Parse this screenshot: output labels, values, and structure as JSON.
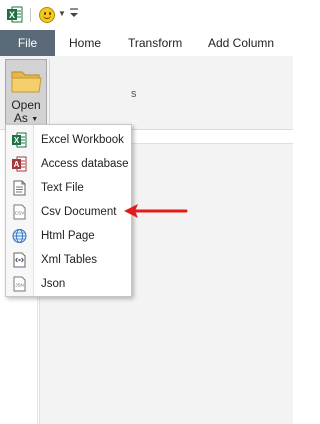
{
  "ribbon_tabs": [
    "File",
    "Home",
    "Transform",
    "Add Column"
  ],
  "open_as": {
    "line1": "Open",
    "line2": "As"
  },
  "menu_items": [
    {
      "label": "Excel Workbook",
      "icon": "excel-icon"
    },
    {
      "label": "Access database",
      "icon": "access-icon"
    },
    {
      "label": "Text File",
      "icon": "text-file-icon"
    },
    {
      "label": "Csv Document",
      "icon": "csv-icon"
    },
    {
      "label": "Html Page",
      "icon": "globe-icon"
    },
    {
      "label": "Xml Tables",
      "icon": "xml-icon"
    },
    {
      "label": "Json",
      "icon": "json-icon"
    }
  ],
  "colors": {
    "file_tab": "#5b6a79",
    "arrow": "#e31b1b",
    "excel_green": "#1e7145",
    "access_red": "#a4373a"
  }
}
